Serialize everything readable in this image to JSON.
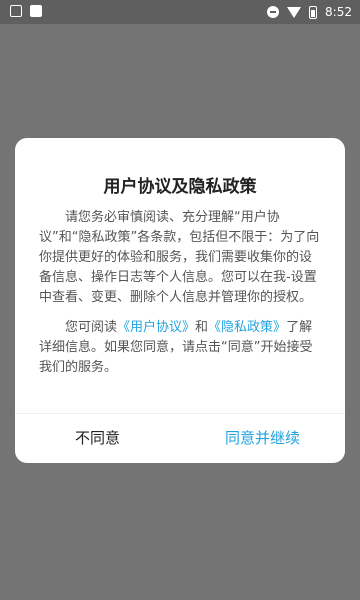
{
  "status_bar": {
    "time": "8:52",
    "left_icons": [
      "image-notification-icon",
      "app-notification-icon"
    ],
    "right_icons": [
      "do-not-disturb-icon",
      "wifi-icon",
      "battery-icon"
    ]
  },
  "dialog": {
    "title": "用户协议及隐私政策",
    "paragraph1": "请您务必审慎阅读、充分理解“用户协议”和“隐私政策”各条款，包括但不限于：为了向你提供更好的体验和服务，我们需要收集你的设备信息、操作日志等个人信息。您可以在我-设置 中查看、变更、删除个人信息并管理你的授权。",
    "paragraph2": {
      "prefix": "您可阅读",
      "user_agreement_link": "《用户协议》",
      "and": "和",
      "privacy_policy_link": "《隐私政策》",
      "suffix": "了解详细信息。如果您同意，请点击“同意”开始接受我们的服务。"
    },
    "decline_label": "不同意",
    "accept_label": "同意并继续"
  },
  "colors": {
    "overlay": "#747474",
    "status_bar": "#5f5f5f",
    "accent": "#22a3e0",
    "dialog_bg": "#ffffff"
  }
}
